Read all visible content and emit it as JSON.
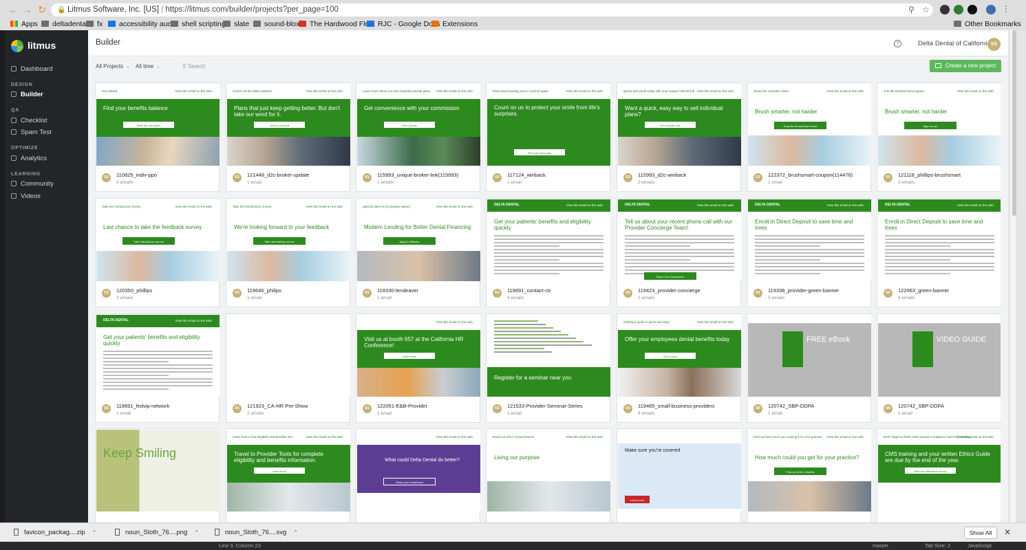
{
  "browser": {
    "site_identity": "Litmus Software, Inc. [US]",
    "url": "https://litmus.com/builder/projects?per_page=100",
    "bookmarks": [
      "Apps",
      "deltadental",
      "fx",
      "accessibility audit",
      "shell scripting",
      "slate",
      "sound-blox",
      "The Hardwood Flo...",
      "RJC - Google Docs",
      "Extensions"
    ],
    "other_bookmarks": "Other Bookmarks"
  },
  "sidebar": {
    "brand": "litmus",
    "dashboard": "Dashboard",
    "sections": {
      "design": "DESIGN",
      "qa": "QA",
      "optimize": "OPTIMIZE",
      "learning": "LEARNING"
    },
    "builder": "Builder",
    "checklist": "Checklist",
    "spam_test": "Spam Test",
    "analytics": "Analytics",
    "community": "Community",
    "videos": "Videos"
  },
  "header": {
    "title": "Builder",
    "help": "?",
    "org": "Delta Dental of California",
    "avatar": "SS"
  },
  "filters": {
    "projects": "All Projects",
    "time": "All time",
    "search_placeholder": "Search",
    "create_button": "Create a new project"
  },
  "projects": [
    {
      "name": "110825_indiv-ppo",
      "count": "3 emails",
      "headline": "Find your benefits balance",
      "cta": "Meet the new plans",
      "pre": "Get started.",
      "avatar": "SS"
    },
    {
      "name": "121448_d2c-broker-update",
      "count": "1 email",
      "headline": "Plans that just keep getting better. But don't take our word for it.",
      "cta": "See for yourself",
      "pre": "Check out the latest updates.",
      "avatar": "SS"
    },
    {
      "name": "115993_unique-broker-link(115993)",
      "count": "2 emails",
      "headline": "Get convenience with your commission",
      "cta": "Get a Quote",
      "pre": "Learn more about our new individual dental plans.",
      "avatar": "SS"
    },
    {
      "name": "117124_winback",
      "count": "1 email",
      "headline": "Count on us to protect your smile from life's surprises.",
      "cta": "Find your best plan",
      "pre": "Rest easy knowing you're covered again.",
      "avatar": "SS"
    },
    {
      "name": "115993_d2c-winback",
      "count": "2 emails",
      "headline": "Want a quick, easy way to sell individual plans?",
      "cta": "Get a quote now",
      "pre": "Quote and enroll today with your unique referral link.",
      "avatar": "SS"
    },
    {
      "name": "122372_brushsmart-coupon(114476)",
      "count": "1 email",
      "headline": "Brush smarter, not harder",
      "cta": "Shop the BrushSmart Store",
      "pre": "Share the complete clean.",
      "avatar": "SS"
    },
    {
      "name": "121118_phillips-brushsmart",
      "count": "3 emails",
      "headline": "Brush smarter, not harder",
      "cta": "Sign me up!",
      "pre": "Join the BrushSmart program.",
      "avatar": "SS"
    },
    {
      "name": "120350_phillips",
      "count": "2 emails",
      "headline": "Last chance to take the feedback survey",
      "cta": "Take introductory survey",
      "pre": "Take the introductory survey.",
      "avatar": "SS"
    },
    {
      "name": "119646_philips",
      "count": "1 email",
      "headline": "We're looking forward to your feedback",
      "cta": "Take introductory survey",
      "pre": "Take the introductory survey.",
      "avatar": "SS"
    },
    {
      "name": "119330-lendeaver",
      "count": "1 email",
      "headline": "Modern Lending for Better Dental Financing",
      "cta": "Apply in Minutes",
      "pre": "Special rates for [Company Name]",
      "avatar": "SS"
    },
    {
      "name": "119691_contact-ctr",
      "count": "4 emails",
      "headline": "Get your patients' benefits and eligibility quickly",
      "cta": "",
      "pre": "DELTA DENTAL",
      "avatar": "SS"
    },
    {
      "name": "119423_provider-concierge",
      "count": "2 emails",
      "headline": "Tell us about your recent phone call with our Provider Concierge Team!",
      "cta": "Share Your Experience",
      "pre": "DELTA DENTAL",
      "avatar": "SS"
    },
    {
      "name": "119338_provider-green-banner",
      "count": "3 emails",
      "headline": "Enroll in Direct Deposit to save time and trees",
      "cta": "",
      "pre": "DELTA DENTAL",
      "avatar": "SS"
    },
    {
      "name": "122063_green-banner",
      "count": "4 emails",
      "headline": "Enroll in Direct Deposit to save time and trees",
      "cta": "",
      "pre": "DELTA DENTAL",
      "avatar": "SS"
    },
    {
      "name": "119691_fedvip-network",
      "count": "1 email",
      "headline": "Get your patients' benefits and eligibility quickly",
      "cta": "",
      "pre": "DELTA DENTAL",
      "avatar": "SS"
    },
    {
      "name": "121923_CA-HR-Pre-Show",
      "count": "2 emails",
      "headline": "",
      "cta": "",
      "pre": "",
      "avatar": "SS"
    },
    {
      "name": "122051-E&B-Provider",
      "count": "1 email",
      "headline": "Visit us at booth 657 at the California HR Conference!",
      "cta": "Learn More",
      "pre": "",
      "avatar": "SS"
    },
    {
      "name": "121533-Provider-Seminar-Series",
      "count": "1 email",
      "headline": "Register for a seminar near you",
      "cta": "",
      "pre": "",
      "avatar": "SS"
    },
    {
      "name": "119465_small-business-providers",
      "count": "8 emails",
      "headline": "Offer your employees dental benefits today",
      "cta": "Get a quote",
      "pre": "Getting a quote is quick and easy.",
      "avatar": "SS"
    },
    {
      "name": "120742_SBP-DDPA",
      "count": "1 email",
      "headline": "FREE eBook",
      "cta": "",
      "pre": "",
      "avatar": "SB"
    },
    {
      "name": "120742_SBP-DDPA",
      "count": "1 email",
      "headline": "VIDEO GUIDE",
      "cta": "",
      "pre": "",
      "avatar": "SB"
    },
    {
      "name": "",
      "count": "",
      "headline": "Keep Smiling",
      "cta": "",
      "pre": "",
      "avatar": ""
    },
    {
      "name": "",
      "count": "",
      "headline": "Travel to Provider Tools for complete eligibility and benefits information.",
      "cta": "Learn More",
      "pre": "Learn how to find eligibility and benefits info.",
      "avatar": ""
    },
    {
      "name": "",
      "count": "",
      "headline": "What could Delta Dental do better?",
      "cta": "Share your experience",
      "pre": "",
      "avatar": ""
    },
    {
      "name": "",
      "count": "",
      "headline": "Living our purpose",
      "cta": "",
      "pre": "Read our 2017 Annual Report.",
      "avatar": ""
    },
    {
      "name": "",
      "count": "",
      "headline": "Make sure you're covered",
      "cta": "Learn more",
      "pre": "",
      "avatar": ""
    },
    {
      "name": "",
      "count": "",
      "headline": "How much could you get for your practice?",
      "cta": "Find out in five minutes",
      "pre": "Find out how much you could get for your practice.",
      "avatar": ""
    },
    {
      "name": "",
      "count": "",
      "headline": "CMS training and your written Ethics Guide are due by the end of the year.",
      "cta": "Take the attestation survey",
      "pre": "Don't forget to finish CMS annual Compliance and FWA training.",
      "avatar": ""
    }
  ],
  "view_link": "View this email on the web.",
  "downloads": {
    "items": [
      "favicon_packag....zip",
      "noun_Sloth_76....png",
      "noun_Sloth_76....svg"
    ],
    "show_all": "Show All"
  },
  "statusbar": {
    "position": "Line 3, Column 23",
    "branch": "master",
    "tab_size": "Tab Size: 2",
    "language": "JavaScript"
  }
}
